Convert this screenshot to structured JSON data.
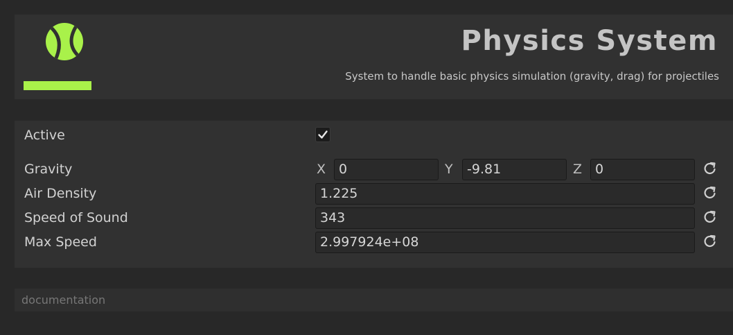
{
  "header": {
    "title": "Physics System",
    "description": "System to handle basic physics simulation (gravity, drag) for projectiles",
    "logo_icon": "tennis-ball-icon",
    "accent_color": "#a9f14a"
  },
  "properties": {
    "active": {
      "label": "Active",
      "checked": true
    },
    "gravity": {
      "label": "Gravity",
      "x_label": "X",
      "x": "0",
      "y_label": "Y",
      "y": "-9.81",
      "z_label": "Z",
      "z": "0"
    },
    "air_density": {
      "label": "Air Density",
      "value": "1.225"
    },
    "speed_of_sound": {
      "label": "Speed of Sound",
      "value": "343"
    },
    "max_speed": {
      "label": "Max Speed",
      "value": "2.997924e+08"
    },
    "reset_icon": "reset-icon"
  },
  "documentation": {
    "label": "documentation"
  }
}
